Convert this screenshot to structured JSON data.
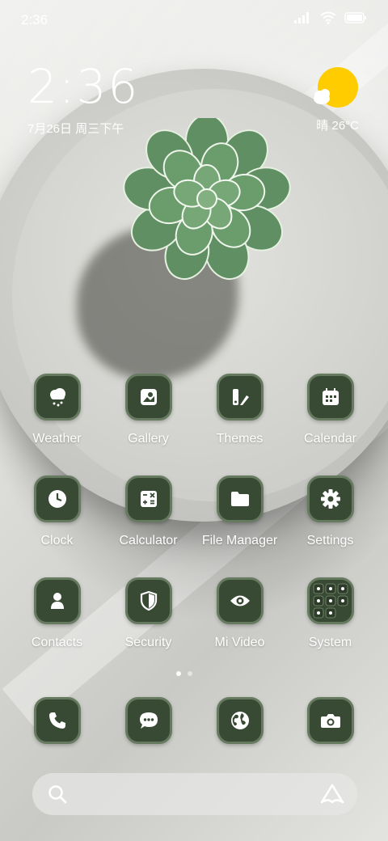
{
  "status_bar": {
    "time": "2:36",
    "icons": [
      "signal-icon",
      "wifi-icon",
      "battery-icon"
    ]
  },
  "clock_widget": {
    "time": "2:36",
    "date": "7月26日 周三下午"
  },
  "weather_widget": {
    "condition": "晴",
    "temperature": "26°C",
    "icon": "sun-cloud-icon"
  },
  "apps": [
    {
      "label": "Weather",
      "icon": "cloud-snow-icon"
    },
    {
      "label": "Gallery",
      "icon": "image-icon"
    },
    {
      "label": "Themes",
      "icon": "brush-icon"
    },
    {
      "label": "Calendar",
      "icon": "calendar-icon"
    },
    {
      "label": "Clock",
      "icon": "clock-icon"
    },
    {
      "label": "Calculator",
      "icon": "calculator-icon"
    },
    {
      "label": "File Manager",
      "icon": "folder-icon"
    },
    {
      "label": "Settings",
      "icon": "gear-icon"
    },
    {
      "label": "Contacts",
      "icon": "person-icon"
    },
    {
      "label": "Security",
      "icon": "shield-icon"
    },
    {
      "label": "Mi Video",
      "icon": "eye-icon"
    },
    {
      "label": "System",
      "icon": "folder-grid-icon"
    }
  ],
  "page_indicator": {
    "current": 1,
    "total": 2
  },
  "dock": [
    {
      "name": "phone",
      "icon": "phone-icon"
    },
    {
      "name": "messages",
      "icon": "chat-icon"
    },
    {
      "name": "browser",
      "icon": "globe-icon"
    },
    {
      "name": "camera",
      "icon": "camera-icon"
    }
  ],
  "search_bar": {
    "left_icon": "search-icon",
    "right_icon": "assistant-icon"
  },
  "colors": {
    "icon_bg": "#384a33",
    "icon_border": "#667a60",
    "sun": "#ffcc00"
  }
}
